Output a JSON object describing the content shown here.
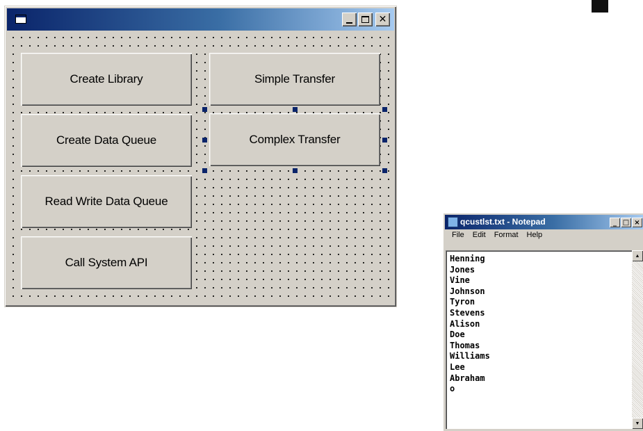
{
  "form": {
    "titlebar_buttons": {
      "minimize_icon": "minimize-icon",
      "maximize_icon": "maximize-icon",
      "close_icon": "close-icon"
    },
    "buttons": [
      {
        "label": "Create Library"
      },
      {
        "label": "Create Data Queue"
      },
      {
        "label": "Read Write Data Queue"
      },
      {
        "label": "Call System API"
      },
      {
        "label": "Simple Transfer"
      },
      {
        "label": "Complex Transfer",
        "selected": true
      }
    ],
    "colors": {
      "face": "#d4d0c8",
      "titlebar_start": "#0a246a",
      "titlebar_end": "#a6caf0",
      "selection_handle": "#0a246a"
    }
  },
  "notepad": {
    "title": "qcustlst.txt - Notepad",
    "menu": [
      "File",
      "Edit",
      "Format",
      "Help"
    ],
    "lines": [
      "Henning",
      "Jones",
      "Vine",
      "Johnson",
      "Tyron",
      "Stevens",
      "Alison",
      "Doe",
      "Thomas",
      "Williams",
      "Lee",
      "Abraham",
      "o"
    ]
  }
}
